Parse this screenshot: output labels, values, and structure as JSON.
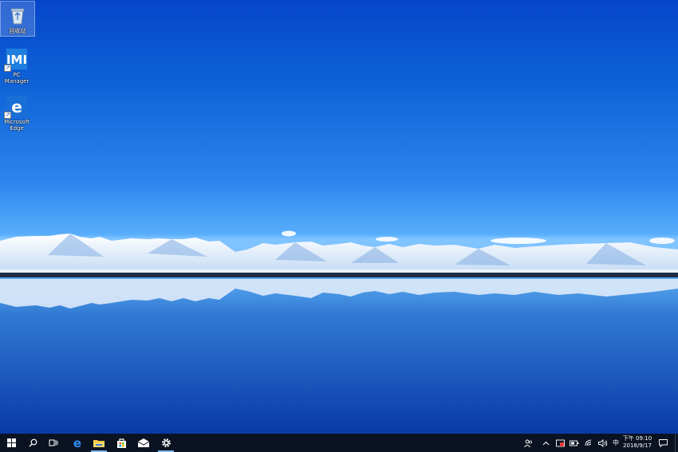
{
  "desktop": {
    "icons": [
      {
        "label": "回收站",
        "icon": "recycle-bin-icon"
      },
      {
        "label": "PC Manager",
        "icon": "pc-manager-icon"
      },
      {
        "label": "Microsoft Edge",
        "icon": "edge-icon"
      }
    ],
    "wallpaper": "snow-mountains-lake"
  },
  "taskbar": {
    "pinned": [
      {
        "name": "start",
        "icon": "windows-logo-icon"
      },
      {
        "name": "search",
        "icon": "search-icon"
      },
      {
        "name": "task-view",
        "icon": "task-view-icon"
      },
      {
        "name": "edge",
        "icon": "edge-icon"
      },
      {
        "name": "file-explorer",
        "icon": "folder-icon"
      },
      {
        "name": "store",
        "icon": "store-bag-icon"
      },
      {
        "name": "mail",
        "icon": "mail-icon"
      },
      {
        "name": "settings",
        "icon": "gear-icon"
      }
    ],
    "tray": {
      "ime": "中",
      "clock_period_time": "下午 09:10",
      "clock_date": "2018/9/17"
    },
    "colors": {
      "background": "#0b1322",
      "active_indicator": "#7cb8ee"
    }
  }
}
